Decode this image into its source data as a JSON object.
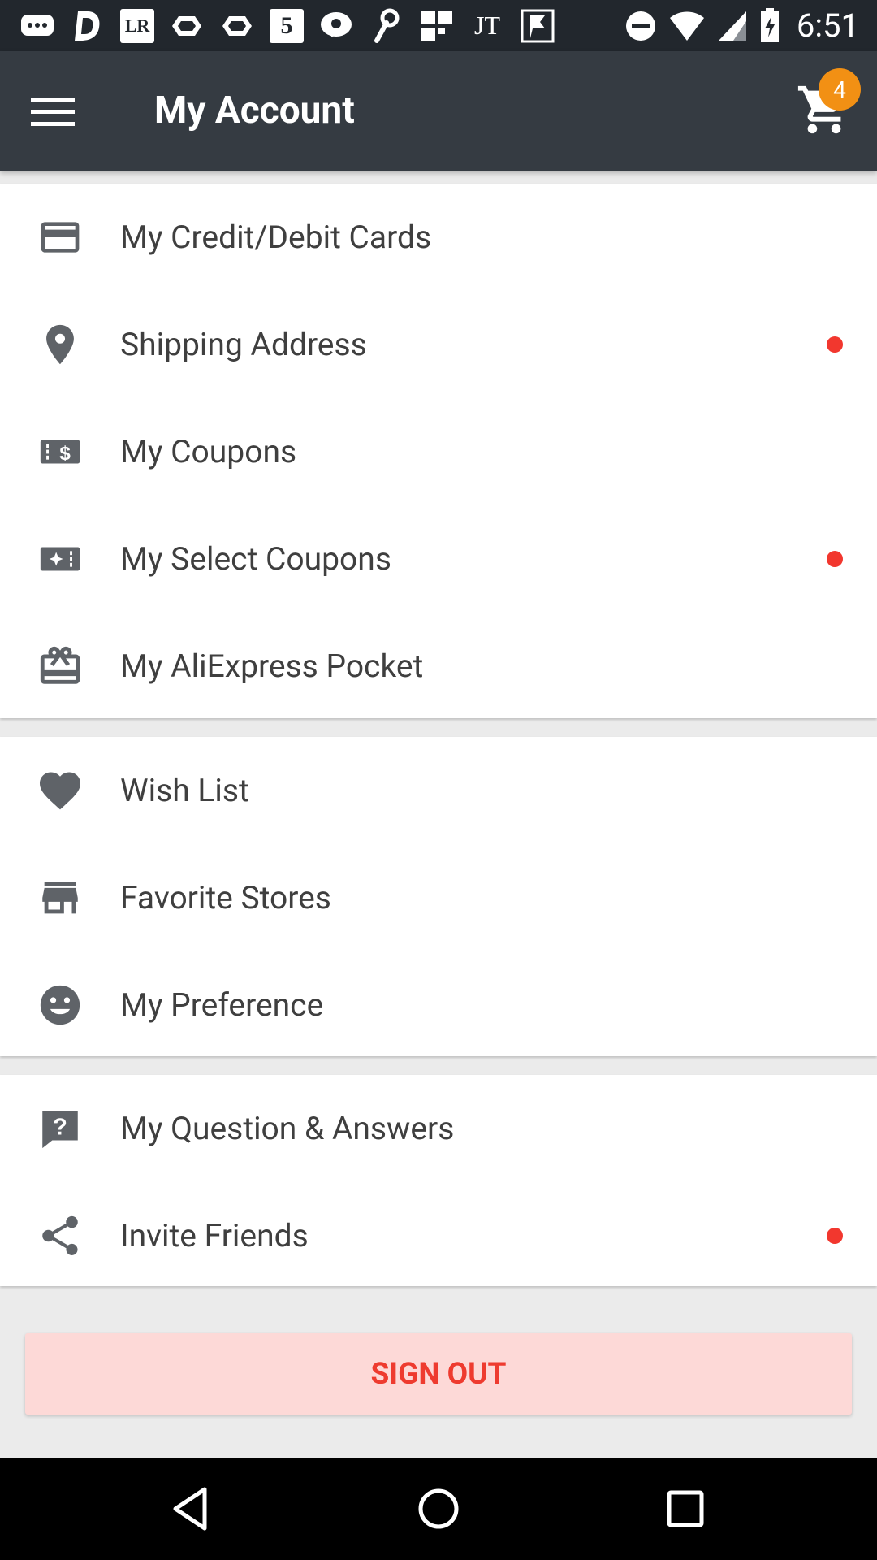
{
  "status_bar": {
    "time": "6:51",
    "notification_icons": [
      "messages-icon",
      "d-app-icon",
      "LR",
      "prime-video-icon",
      "prime-video-icon",
      "5",
      "p-app-icon",
      "link-icon",
      "grid-app-icon",
      "JT",
      "flag-app-icon"
    ],
    "lr_text": "LR",
    "five_text": "5",
    "jt_text": "JT"
  },
  "toolbar": {
    "title": "My Account",
    "cart_count": "4"
  },
  "sections": [
    {
      "items": [
        {
          "label": "My Credit/Debit Cards",
          "icon": "credit-card-icon",
          "dot": false
        },
        {
          "label": "Shipping Address",
          "icon": "location-pin-icon",
          "dot": true
        },
        {
          "label": "My Coupons",
          "icon": "coupon-icon",
          "dot": false
        },
        {
          "label": "My Select Coupons",
          "icon": "select-coupon-icon",
          "dot": true
        },
        {
          "label": "My AliExpress Pocket",
          "icon": "gift-card-icon",
          "dot": false
        }
      ]
    },
    {
      "items": [
        {
          "label": "Wish List",
          "icon": "heart-icon",
          "dot": false
        },
        {
          "label": "Favorite Stores",
          "icon": "store-icon",
          "dot": false
        },
        {
          "label": "My Preference",
          "icon": "smiley-icon",
          "dot": false
        }
      ]
    },
    {
      "items": [
        {
          "label": "My Question & Answers",
          "icon": "question-icon",
          "dot": false
        },
        {
          "label": "Invite Friends",
          "icon": "share-icon",
          "dot": true
        }
      ]
    }
  ],
  "sign_out_label": "SIGN OUT",
  "colors": {
    "toolbar": "#353b42",
    "badge": "#f29014",
    "dot": "#f2372e",
    "sign_out_bg": "#fdd9d7",
    "sign_out_text": "#ee3b2f",
    "icon": "#5f6368"
  }
}
